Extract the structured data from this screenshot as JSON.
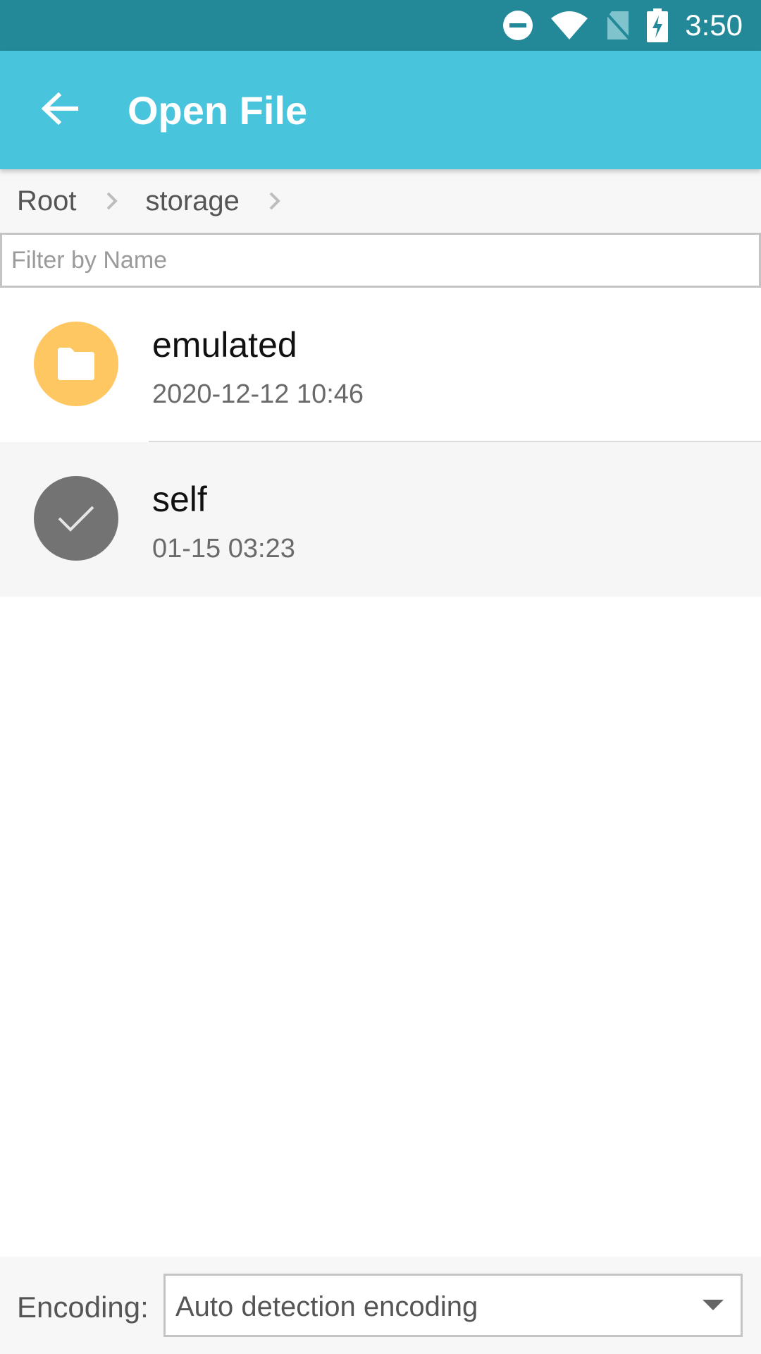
{
  "status_bar": {
    "time": "3:50",
    "icons": [
      "do-not-disturb-icon",
      "wifi-icon",
      "no-sim-icon",
      "battery-charging-icon"
    ]
  },
  "app_bar": {
    "title": "Open File",
    "back_icon": "arrow-back-icon",
    "color": "#48c4dd"
  },
  "breadcrumb": {
    "items": [
      "Root",
      "storage"
    ]
  },
  "filter": {
    "placeholder": "Filter by Name",
    "value": ""
  },
  "files": [
    {
      "name": "emulated",
      "date": "2020-12-12 10:46",
      "icon": "folder-icon",
      "selected": false
    },
    {
      "name": "self",
      "date": "01-15 03:23",
      "icon": "check-icon",
      "selected": true
    }
  ],
  "encoding": {
    "label": "Encoding:",
    "value": "Auto detection encoding",
    "arrow_icon": "dropdown-arrow-icon"
  }
}
